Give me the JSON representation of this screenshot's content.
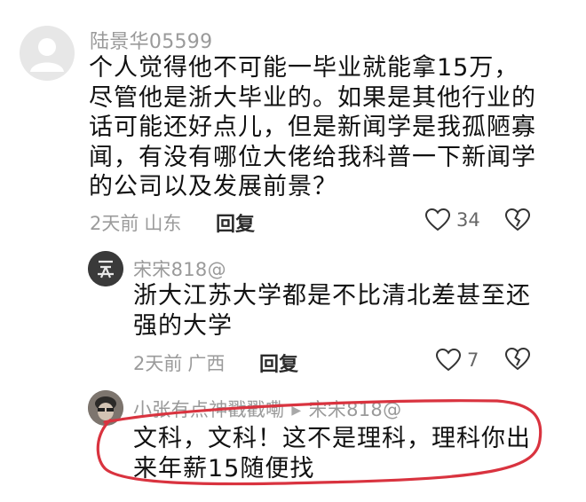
{
  "comments": [
    {
      "username": "陆景华05599",
      "lines": [
        "个人觉得他不可能一毕业就能拿15万，",
        "尽管他是浙大毕业的。如果是其他行业的",
        "话可能还好点儿，但是新闻学是我孤陋寡",
        "闻，有没有哪位大佬给我科普一下新闻学",
        "的公司以及发展前景？"
      ],
      "date": "2天前",
      "location": "山东",
      "reply_label": "回复",
      "like_count": "34",
      "avatar_icon": "default-avatar-icon"
    },
    {
      "username": "宋宋818@",
      "lines": [
        "浙大江苏大学都是不比清北差甚至还",
        "强的大学"
      ],
      "date": "2天前",
      "location": "广西",
      "reply_label": "回复",
      "like_count": "7",
      "avatar_icon": "user-avatar-icon"
    },
    {
      "username": "小张有点神戳戳嘞",
      "reply_to": "宋宋818@",
      "lines": [
        "文科，文科！这不是理科，理科你出",
        "来年薪15随便找"
      ],
      "avatar_icon": "user-avatar-icon"
    }
  ],
  "colors": {
    "text": "#111111",
    "username": "#9a9a9a",
    "meta": "#9b9b9b",
    "annotation_ellipse": "#d9333f"
  },
  "icons": [
    "heart-outline-icon",
    "broken-heart-icon",
    "reply-arrow-icon"
  ]
}
